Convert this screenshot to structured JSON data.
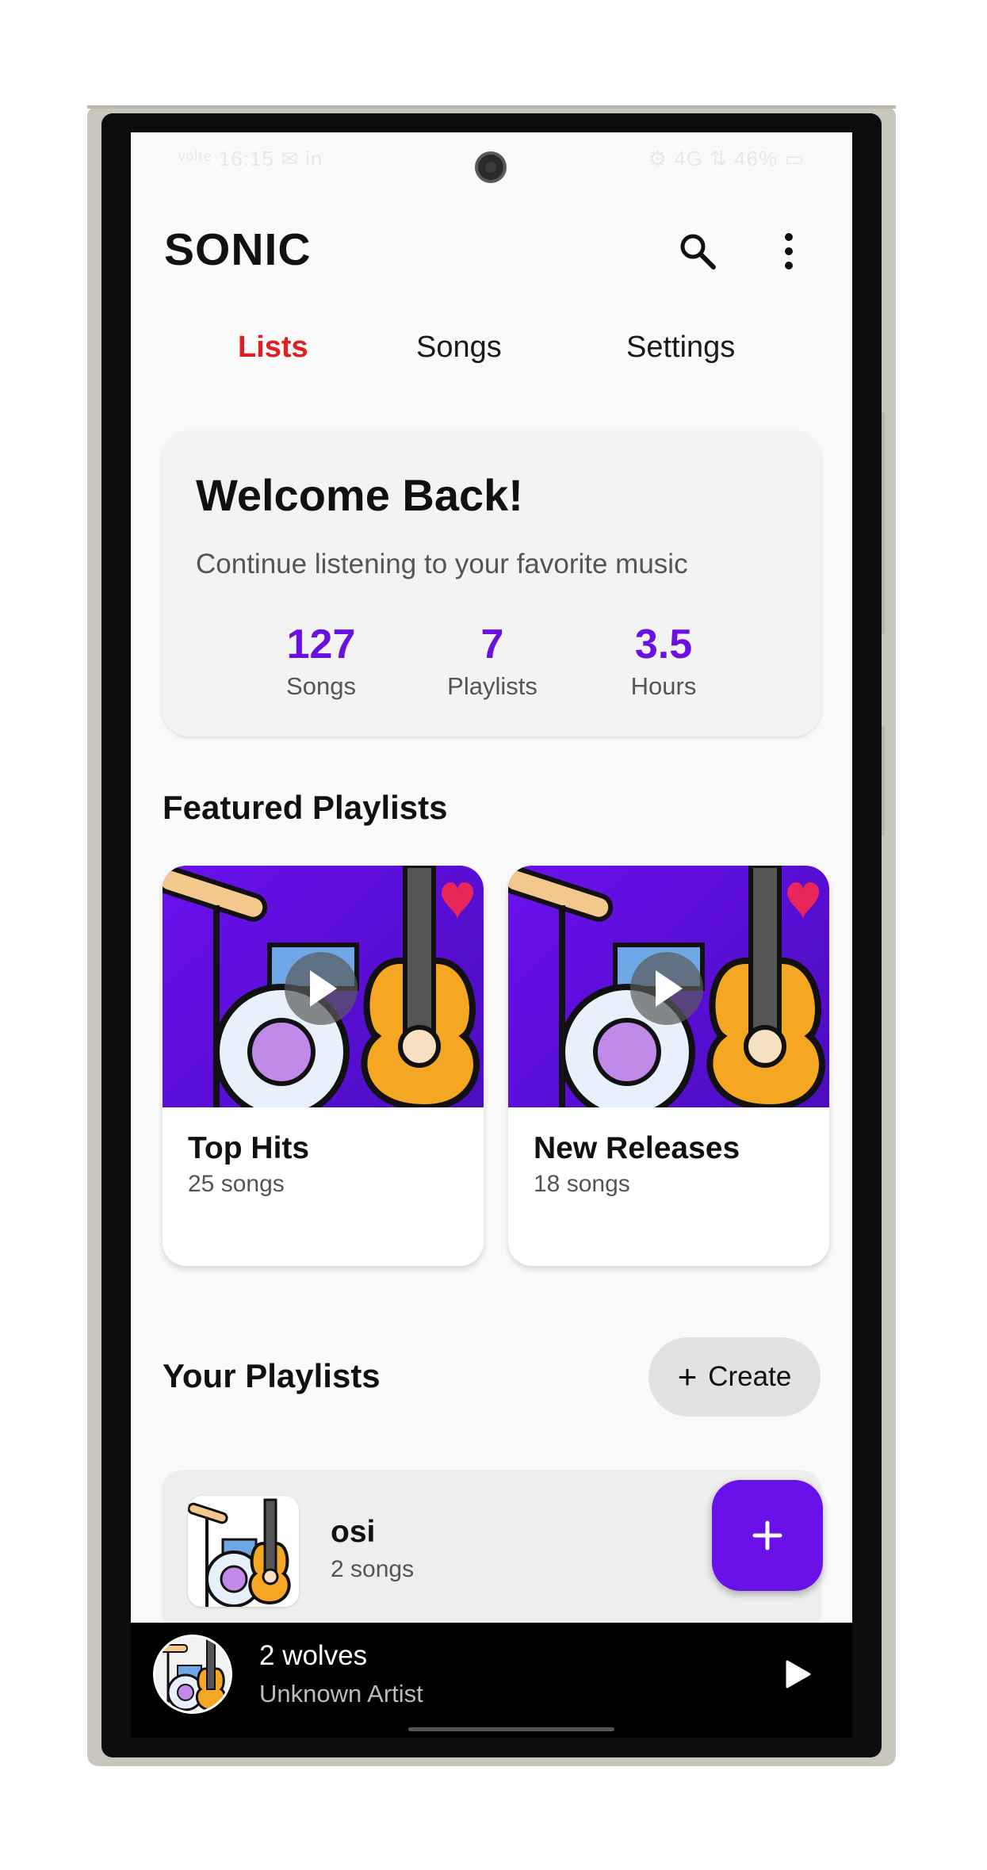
{
  "status_bar": {
    "left": "ᵛᵒˡᵗᵉ 16:15 ✉ in",
    "right": "⚙ 4G ⇅ 46% ▭"
  },
  "header": {
    "title": "SONIC",
    "search_icon": "search-icon",
    "more_icon": "more-vertical-icon"
  },
  "tabs": [
    {
      "label": "Lists",
      "active": true
    },
    {
      "label": "Songs",
      "active": false
    },
    {
      "label": "Settings",
      "active": false
    }
  ],
  "welcome": {
    "title": "Welcome Back!",
    "subtitle": "Continue listening to your favorite music",
    "stats": [
      {
        "value": "127",
        "label": "Songs"
      },
      {
        "value": "7",
        "label": "Playlists"
      },
      {
        "value": "3.5",
        "label": "Hours"
      }
    ]
  },
  "featured": {
    "title": "Featured Playlists",
    "items": [
      {
        "name": "Top Hits",
        "count": "25 songs"
      },
      {
        "name": "New Releases",
        "count": "18 songs"
      }
    ]
  },
  "your_playlists": {
    "title": "Your Playlists",
    "create_label": "Create",
    "items": [
      {
        "name": "osi",
        "count": "2 songs"
      }
    ]
  },
  "now_playing": {
    "title": "2 wolves",
    "artist": "Unknown Artist"
  },
  "colors": {
    "accent": "#6a10e8",
    "active_tab": "#e02020",
    "heart": "#e8265a"
  }
}
